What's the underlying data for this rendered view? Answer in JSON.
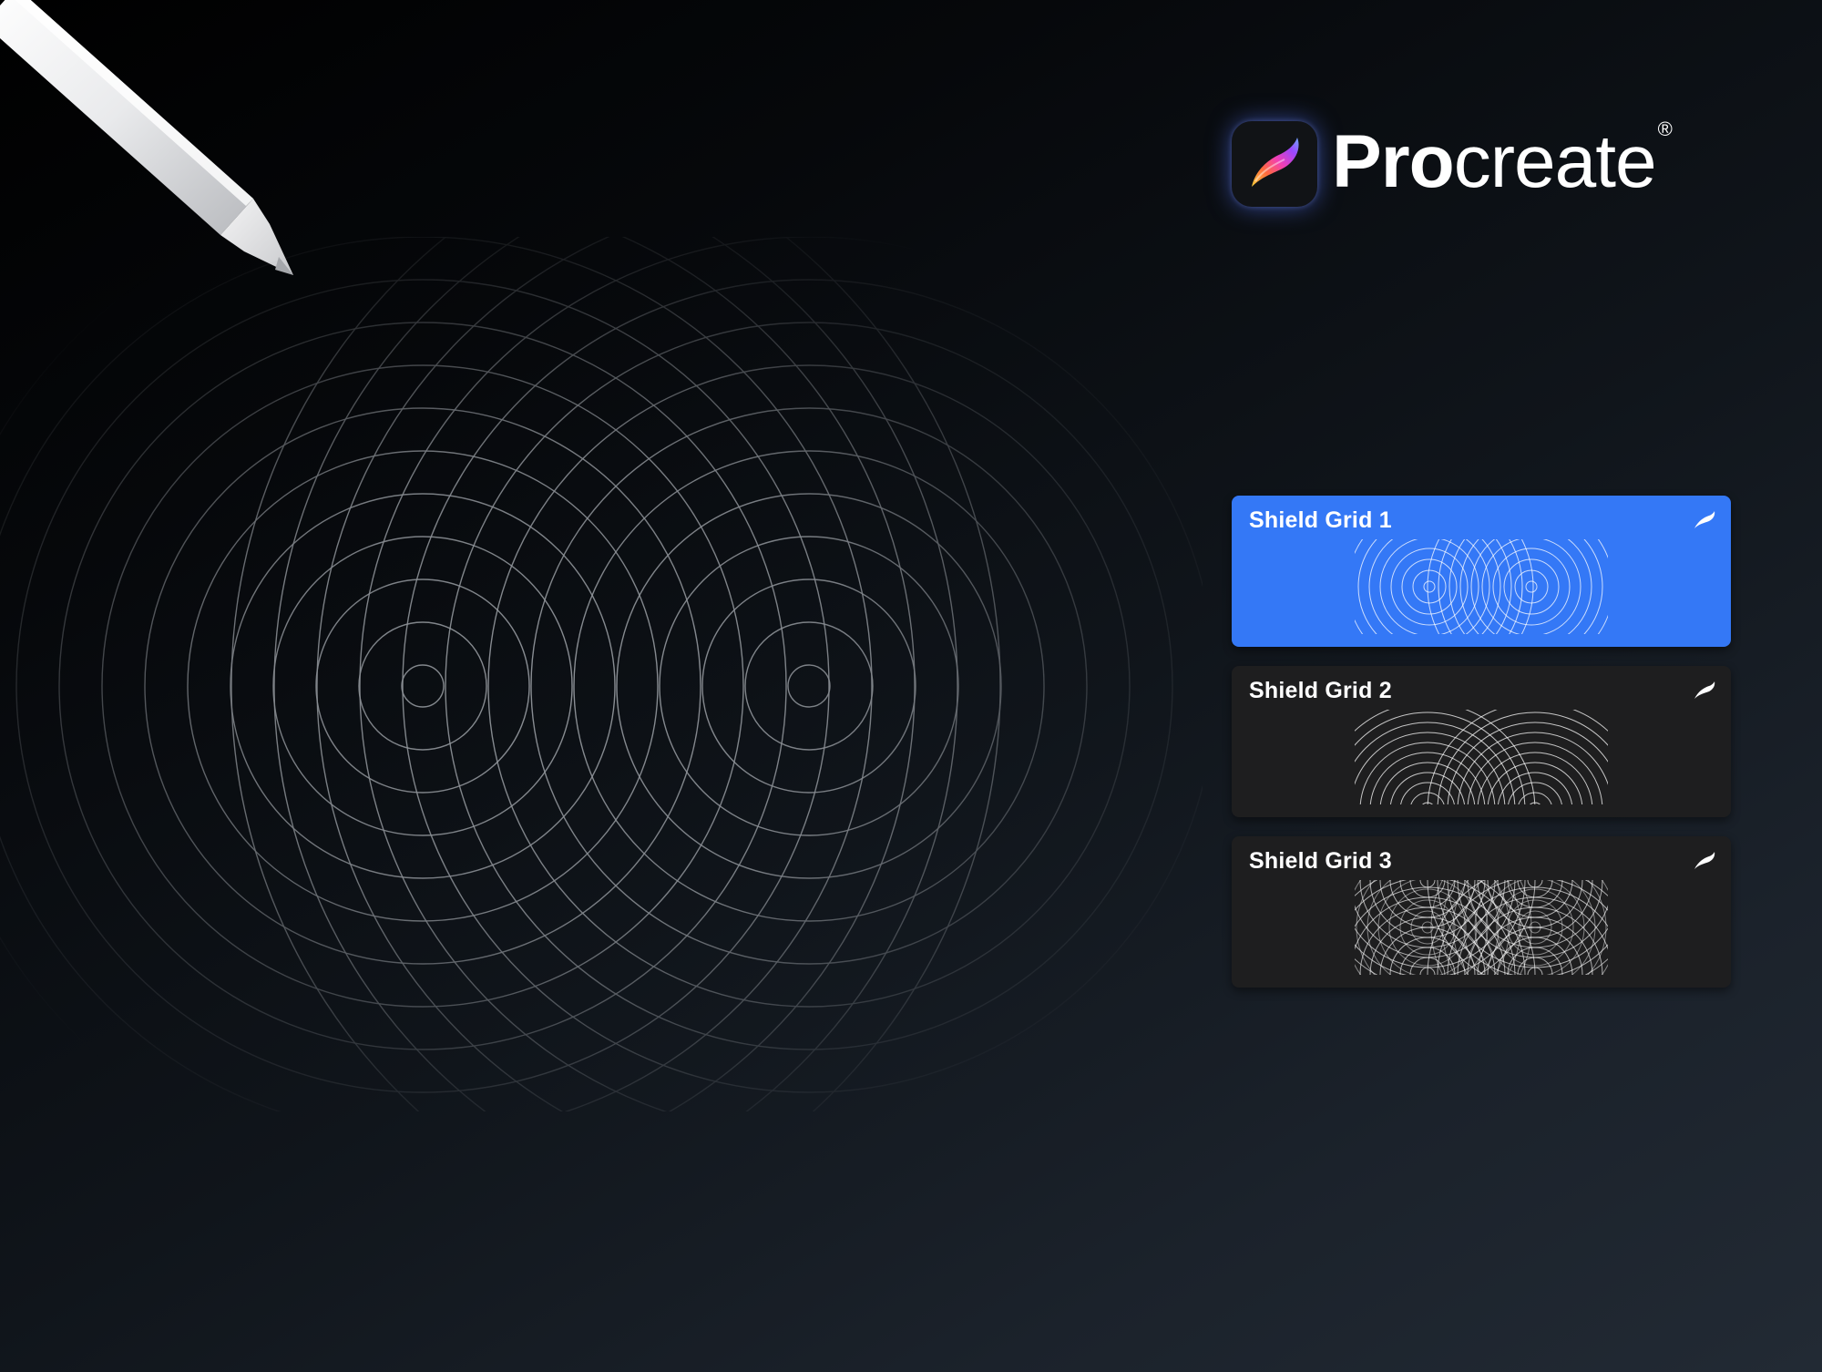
{
  "brand": {
    "name_bold": "Pro",
    "name_regular": "create",
    "registered_mark": "®",
    "icon": "procreate-brush-icon"
  },
  "stylus": {
    "icon": "apple-pencil-icon"
  },
  "grid_list": {
    "items": [
      {
        "title": "Shield Grid 1",
        "selected": true,
        "icon": "procreate-brush-icon",
        "pattern": "two-centers"
      },
      {
        "title": "Shield Grid 2",
        "selected": false,
        "icon": "procreate-brush-icon",
        "pattern": "bottom-centers"
      },
      {
        "title": "Shield Grid 3",
        "selected": false,
        "icon": "procreate-brush-icon",
        "pattern": "woven"
      }
    ]
  },
  "colors": {
    "selected": "#3478f6",
    "card": "#1e1e1f",
    "grid_line": "#9a9ea4",
    "text": "#ffffff"
  }
}
